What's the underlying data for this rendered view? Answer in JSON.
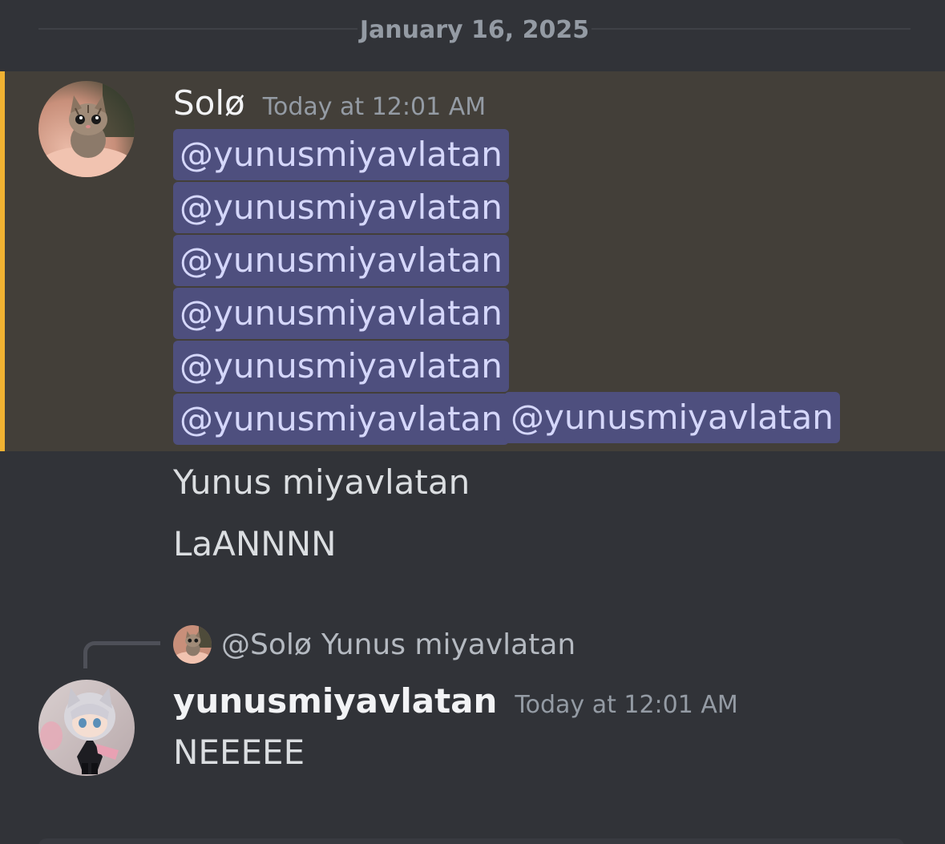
{
  "date_divider": {
    "label": "January 16, 2025"
  },
  "messages": [
    {
      "author": "Solø",
      "timestamp": "Today at 12:01 AM",
      "avatar_icon": "kitten-avatar",
      "mentioned": true,
      "mention_color": "#f0b232",
      "mentions": [
        "@yunusmiyavlatan",
        "@yunusmiyavlatan",
        "@yunusmiyavlatan",
        "@yunusmiyavlatan",
        "@yunusmiyavlatan",
        "@yunusmiyavlatan",
        "@yunusmiyavlatan"
      ],
      "followups": [
        "Yunus miyavlatan",
        "LaANNNN"
      ]
    },
    {
      "author": "yunusmiyavlatan",
      "timestamp": "Today at 12:01 AM",
      "avatar_icon": "anime-figure-avatar",
      "reply": {
        "avatar_icon": "kitten-avatar",
        "author": "@Solø",
        "content": "Yunus miyavlatan"
      },
      "text": "NEEEEE"
    }
  ],
  "colors": {
    "background": "#313338",
    "mention_highlight": "#433f39",
    "mention_pill": "#4e4f7e",
    "mention_text": "#d5d7fb"
  }
}
